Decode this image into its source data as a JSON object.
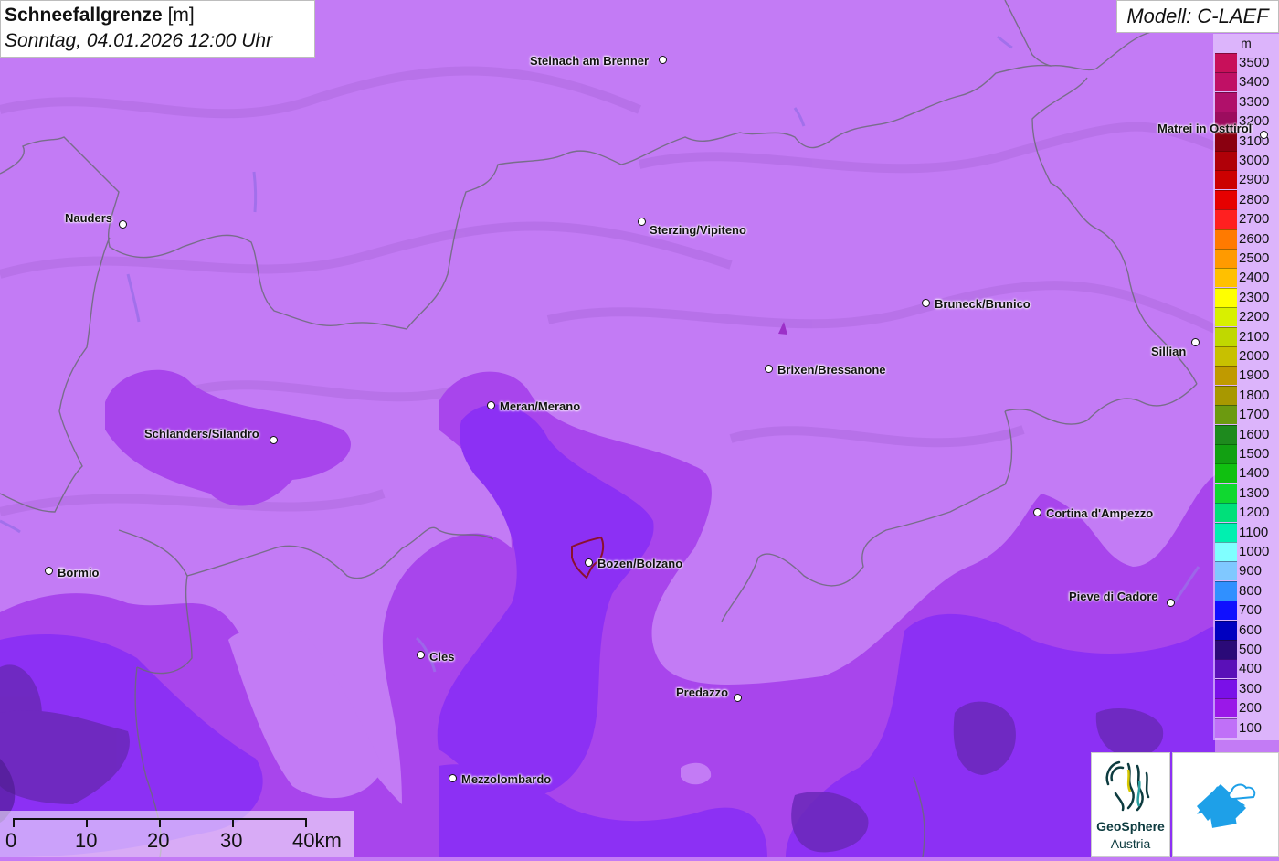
{
  "header": {
    "title_bold": "Schneefallgrenze",
    "title_unit": "[m]",
    "datetime": "Sonntag, 04.01.2026 12:00 Uhr"
  },
  "model": {
    "label": "Modell: C-LAEF"
  },
  "legend": {
    "unit": "m",
    "items": [
      {
        "value": "3500",
        "color": "#c8105a"
      },
      {
        "value": "3400",
        "color": "#c01065"
      },
      {
        "value": "3300",
        "color": "#b0106a"
      },
      {
        "value": "3200",
        "color": "#9c0c5e"
      },
      {
        "value": "3100",
        "color": "#8a0010"
      },
      {
        "value": "3000",
        "color": "#b00008"
      },
      {
        "value": "2900",
        "color": "#cc0000"
      },
      {
        "value": "2800",
        "color": "#e60000"
      },
      {
        "value": "2700",
        "color": "#ff2020"
      },
      {
        "value": "2600",
        "color": "#ff7a00"
      },
      {
        "value": "2500",
        "color": "#ff9a00"
      },
      {
        "value": "2400",
        "color": "#ffc000"
      },
      {
        "value": "2300",
        "color": "#ffff00"
      },
      {
        "value": "2200",
        "color": "#d8f000"
      },
      {
        "value": "2100",
        "color": "#c0d800"
      },
      {
        "value": "2000",
        "color": "#c8c000"
      },
      {
        "value": "1900",
        "color": "#c09a00"
      },
      {
        "value": "1800",
        "color": "#a89800"
      },
      {
        "value": "1700",
        "color": "#6c9a10"
      },
      {
        "value": "1600",
        "color": "#1e8a1e"
      },
      {
        "value": "1500",
        "color": "#12a012"
      },
      {
        "value": "1400",
        "color": "#10c010"
      },
      {
        "value": "1300",
        "color": "#10d830"
      },
      {
        "value": "1200",
        "color": "#00e07a"
      },
      {
        "value": "1100",
        "color": "#00f0b0"
      },
      {
        "value": "1000",
        "color": "#80ffff"
      },
      {
        "value": "900",
        "color": "#80c8ff"
      },
      {
        "value": "800",
        "color": "#3090ff"
      },
      {
        "value": "700",
        "color": "#1010ff"
      },
      {
        "value": "600",
        "color": "#0000c0"
      },
      {
        "value": "500",
        "color": "#2a0a78"
      },
      {
        "value": "400",
        "color": "#5a10b8"
      },
      {
        "value": "300",
        "color": "#7a10e8"
      },
      {
        "value": "200",
        "color": "#9a18e8"
      },
      {
        "value": "100",
        "color": "#c070f8"
      }
    ]
  },
  "places": [
    {
      "name": "Steinach am Brenner",
      "dot_side": "right"
    },
    {
      "name": "Nauders",
      "dot_side": "right"
    },
    {
      "name": "Sterzing/Vipiteno",
      "dot_side": "left"
    },
    {
      "name": "Matrei in Osttirol",
      "dot_side": "right"
    },
    {
      "name": "Bruneck/Brunico",
      "dot_side": "left"
    },
    {
      "name": "Sillian",
      "dot_side": "right"
    },
    {
      "name": "Brixen/Bressanone",
      "dot_side": "left"
    },
    {
      "name": "Meran/Merano",
      "dot_side": "left"
    },
    {
      "name": "Schlanders/Silandro",
      "dot_side": "right"
    },
    {
      "name": "Bozen/Bolzano",
      "dot_side": "left"
    },
    {
      "name": "Bormio",
      "dot_side": "left"
    },
    {
      "name": "Cortina d'Ampezzo",
      "dot_side": "left"
    },
    {
      "name": "Pieve di Cadore",
      "dot_side": "right"
    },
    {
      "name": "Cles",
      "dot_side": "left"
    },
    {
      "name": "Predazzo",
      "dot_side": "right"
    },
    {
      "name": "Mezzolombardo",
      "dot_side": "left"
    }
  ],
  "scalebar": {
    "labels": [
      "0",
      "10",
      "20",
      "30",
      "40km"
    ]
  },
  "logos": {
    "geosphere_name": "GeoSphere",
    "geosphere_sub": "Austria"
  }
}
